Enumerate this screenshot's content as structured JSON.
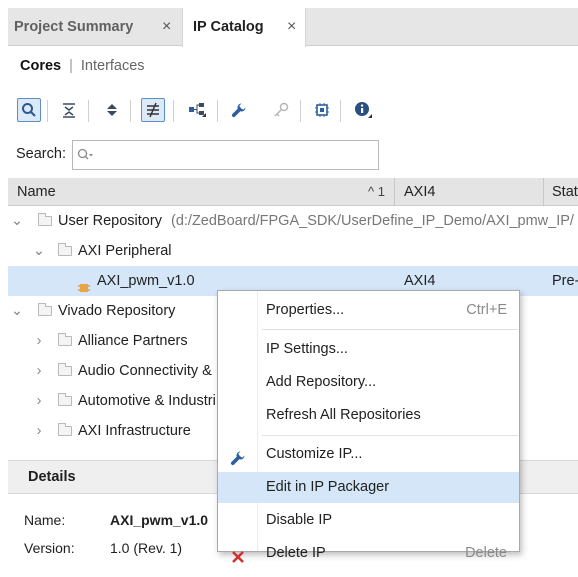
{
  "tabs": [
    {
      "label": "Project Summary",
      "close": "×"
    },
    {
      "label": "IP Catalog",
      "close": "×"
    }
  ],
  "subtabs": {
    "cores": "Cores",
    "separator": "|",
    "interfaces": "Interfaces"
  },
  "toolbar": {
    "icons": [
      "search-icon",
      "collapse-all-icon",
      "expand-all-icon",
      "filter-icon",
      "hierarchy-icon",
      "wrench-icon",
      "key-icon",
      "chip-icon",
      "info-icon"
    ]
  },
  "search": {
    "label": "Search:",
    "value": ""
  },
  "table": {
    "headers": {
      "name": "Name",
      "sort": "^ 1",
      "interfaces": "AXI4",
      "status": "Stat"
    },
    "rows": [
      {
        "name": "User Repository",
        "path": "(d:/ZedBoard/FPGA_SDK/UserDefine_IP_Demo/AXI_pmw_IP/",
        "interfaces": "",
        "status": ""
      },
      {
        "name": "AXI Peripheral",
        "interfaces": "",
        "status": ""
      },
      {
        "name": "AXI_pwm_v1.0",
        "interfaces": "AXI4",
        "status": "Pre-"
      },
      {
        "name": "Vivado Repository",
        "interfaces": "",
        "status": ""
      },
      {
        "name": "Alliance Partners",
        "interfaces": "",
        "status": ""
      },
      {
        "name": "Audio Connectivity &",
        "interfaces": "",
        "status": ""
      },
      {
        "name": "Automotive & Industri",
        "interfaces": "",
        "status": ""
      },
      {
        "name": "AXI Infrastructure",
        "interfaces": "",
        "status": ""
      }
    ]
  },
  "details": {
    "title": "Details",
    "name_label": "Name:",
    "name_value": "AXI_pwm_v1.0",
    "version_label": "Version:",
    "version_value": "1.0 (Rev. 1)"
  },
  "context_menu": {
    "items": [
      {
        "label": "Properties...",
        "shortcut": "Ctrl+E"
      },
      {
        "label": "IP Settings..."
      },
      {
        "label": "Add Repository..."
      },
      {
        "label": "Refresh All Repositories"
      },
      {
        "label": "Customize IP..."
      },
      {
        "label": "Edit in IP Packager"
      },
      {
        "label": "Disable IP"
      },
      {
        "label": "Delete IP",
        "shortcut": "Delete"
      }
    ]
  },
  "colors": {
    "selection": "#d4e6f8",
    "accent": "#2f6db5",
    "wrench": "#2d5f9e",
    "delete_icon": "#d03030"
  }
}
